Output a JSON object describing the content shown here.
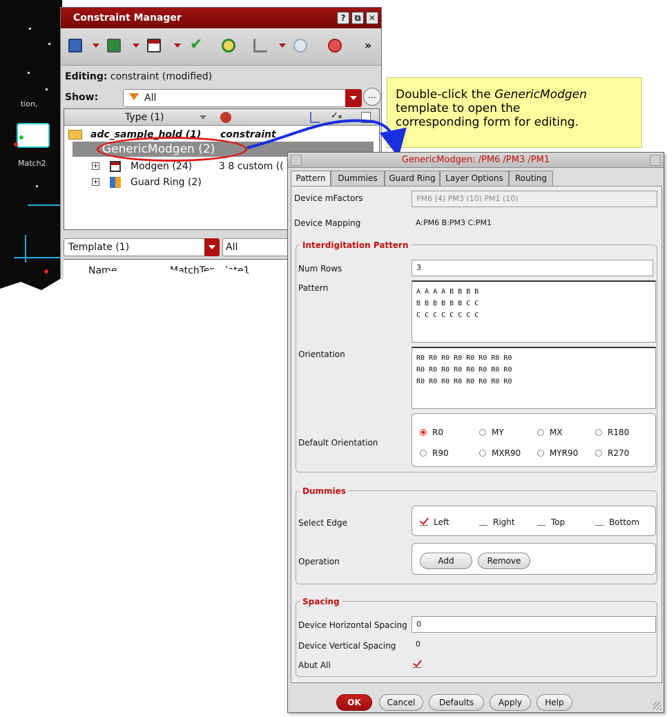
{
  "constraint_manager": {
    "title": "Constraint Manager",
    "window_buttons": [
      "?",
      "⧉",
      "✕"
    ],
    "toolbar_more": "»",
    "editing_label": "Editing:",
    "editing_value": "constraint (modified)",
    "show_label": "Show:",
    "show_value": "All",
    "show_more": "...",
    "tree_header": {
      "type_col": "Type (1)"
    },
    "tree_rows": [
      {
        "label": "adc_sample_hold (1)",
        "value": "constraint"
      },
      {
        "label": "GenericModgen (2)",
        "value": ""
      },
      {
        "label": "Modgen (24)",
        "value": "3 8 custom (("
      },
      {
        "label": "Guard Ring (2)",
        "value": ""
      }
    ],
    "template_select": "Template (1)",
    "second_select": "All",
    "bottom_table_headers": [
      "Name",
      "MatchTemplate1"
    ],
    "canvas_labels": [
      "tion,",
      "Match2"
    ]
  },
  "callout": {
    "line1_pre": "Double-click the ",
    "line1_em": "GenericModgen",
    "line2": "template to open the",
    "line3": "corresponding form for editing."
  },
  "dialog": {
    "title": "GenericModgen: /PM6 /PM3 /PM1",
    "tabs": [
      "Pattern",
      "Dummies",
      "Guard Ring",
      "Layer Options",
      "Routing"
    ],
    "active_tab": "Pattern",
    "device_mfactors_label": "Device mFactors",
    "device_mfactors_value": "PM6 (4) PM3 (10) PM1 (10)",
    "device_mapping_label": "Device Mapping",
    "device_mapping_value": "A:PM6 B:PM3 C:PM1",
    "interdigitation": {
      "title": "Interdigitation Pattern",
      "num_rows_label": "Num Rows",
      "num_rows_value": "3",
      "pattern_label": "Pattern",
      "pattern_value": "A A A A B B B B\nB B B B B B C C\nC C C C C C C C",
      "orientation_label": "Orientation",
      "orientation_value": "R0 R0 R0 R0 R0 R0 R0 R0\nR0 R0 R0 R0 R0 R0 R0 R0\nR0 R0 R0 R0 R0 R0 R0 R0",
      "default_orientation_label": "Default Orientation",
      "orientation_options": [
        "R0",
        "MY",
        "MX",
        "R180",
        "R90",
        "MXR90",
        "MYR90",
        "R270"
      ],
      "orientation_selected": "R0"
    },
    "dummies": {
      "title": "Dummies",
      "select_edge_label": "Select Edge",
      "edges": [
        {
          "label": "Left",
          "checked": true
        },
        {
          "label": "Right",
          "checked": false
        },
        {
          "label": "Top",
          "checked": false
        },
        {
          "label": "Bottom",
          "checked": false
        }
      ],
      "operation_label": "Operation",
      "add_label": "Add",
      "remove_label": "Remove"
    },
    "spacing": {
      "title": "Spacing",
      "h_label": "Device Horizontal Spacing",
      "h_value": "0",
      "v_label": "Device Vertical Spacing",
      "v_value": "0",
      "abut_label": "Abut All",
      "abut_checked": true
    },
    "buttons": {
      "ok": "OK",
      "cancel": "Cancel",
      "defaults": "Defaults",
      "apply": "Apply",
      "help": "Help"
    }
  },
  "colors": {
    "title_red": "#8b0b0b",
    "accent_red": "#c01010",
    "callout_yellow": "#fdfd9d",
    "arrow_blue": "#1a2fe0"
  }
}
